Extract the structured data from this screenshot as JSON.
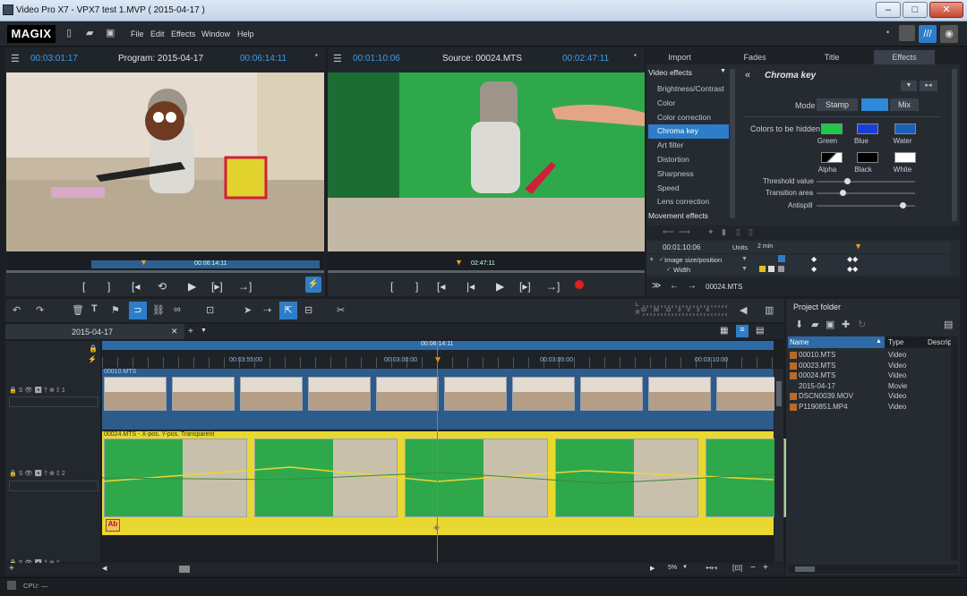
{
  "window": {
    "title": "Video Pro X7 - VPX7 test 1.MVP ( 2015-04-17 )"
  },
  "menu": {
    "logo": "MAGIX",
    "items": [
      "File",
      "Edit",
      "Effects",
      "Window",
      "Help"
    ]
  },
  "program_monitor": {
    "time_left": "00:03:01:17",
    "label": "Program: 2015-04-17",
    "time_right": "00:06:14:11",
    "scrub_time": "00:06:14:11"
  },
  "source_monitor": {
    "time_left": "00:01:10:06",
    "label": "Source: 00024.MTS",
    "time_right": "00:02:47:11",
    "scrub_time": "02:47:11"
  },
  "right_tabs": [
    "Import",
    "Fades",
    "Title",
    "Effects"
  ],
  "effects": {
    "category": "Video effects",
    "items": [
      "Brightness/Contrast",
      "Color",
      "Color correction",
      "Chroma key",
      "Art filter",
      "Distortion",
      "Sharpness",
      "Speed",
      "Lens correction"
    ],
    "next_category": "Movement effects",
    "selected": "Chroma key",
    "panel_title": "Chroma key",
    "mode_label": "Mode",
    "mode_options": [
      "Stamp",
      "",
      "Mix"
    ],
    "colors_label": "Colors to be hidden",
    "colors": [
      {
        "name": "Green",
        "color": "#1ec84a"
      },
      {
        "name": "Blue",
        "color": "#1a3fd8"
      },
      {
        "name": "Water",
        "color": "#1a5fb8"
      },
      {
        "name": "Alpha",
        "color": "#ffffff"
      },
      {
        "name": "Black",
        "color": "#000000"
      },
      {
        "name": "White",
        "color": "#ffffff"
      }
    ],
    "threshold_label": "Threshold value",
    "transition_label": "Transition area",
    "antispill_label": "Antispill",
    "threshold_value": 0.3,
    "transition_value": 0.25,
    "antispill_value": 0.9
  },
  "keyframes": {
    "time": "00:01:10:06",
    "units_label": "Units",
    "units_value": "2 min",
    "rows": [
      "Image size/position",
      "Width"
    ],
    "clip": "00024.MTS"
  },
  "timeline": {
    "project_tab": "2015-04-17",
    "playhead": "00:06:14:11",
    "ruler": [
      "00:03:55:00",
      "00:03:00:00",
      "00:03:05:00",
      "00:03:10:00"
    ],
    "track1_clip": "00010.MTS",
    "track2_clip": "00024.MTS - X-pos. Y-pos. Transparent",
    "track_labels": [
      "1",
      "2"
    ],
    "zoom": "5%",
    "meter_scale": [
      "52",
      "30",
      "12",
      "3",
      "0",
      "3",
      "6"
    ],
    "cpu": "CPU: —"
  },
  "project_folder": {
    "title": "Project folder",
    "columns": [
      "Name",
      "Type",
      "Descript"
    ],
    "rows": [
      {
        "name": "00010.MTS",
        "type": "Video"
      },
      {
        "name": "00023.MTS",
        "type": "Video"
      },
      {
        "name": "00024.MTS",
        "type": "Video"
      },
      {
        "name": "2015-04-17",
        "type": "Movie"
      },
      {
        "name": "DSCN0039.MOV",
        "type": "Video"
      },
      {
        "name": "P1190851.MP4",
        "type": "Video"
      }
    ]
  }
}
